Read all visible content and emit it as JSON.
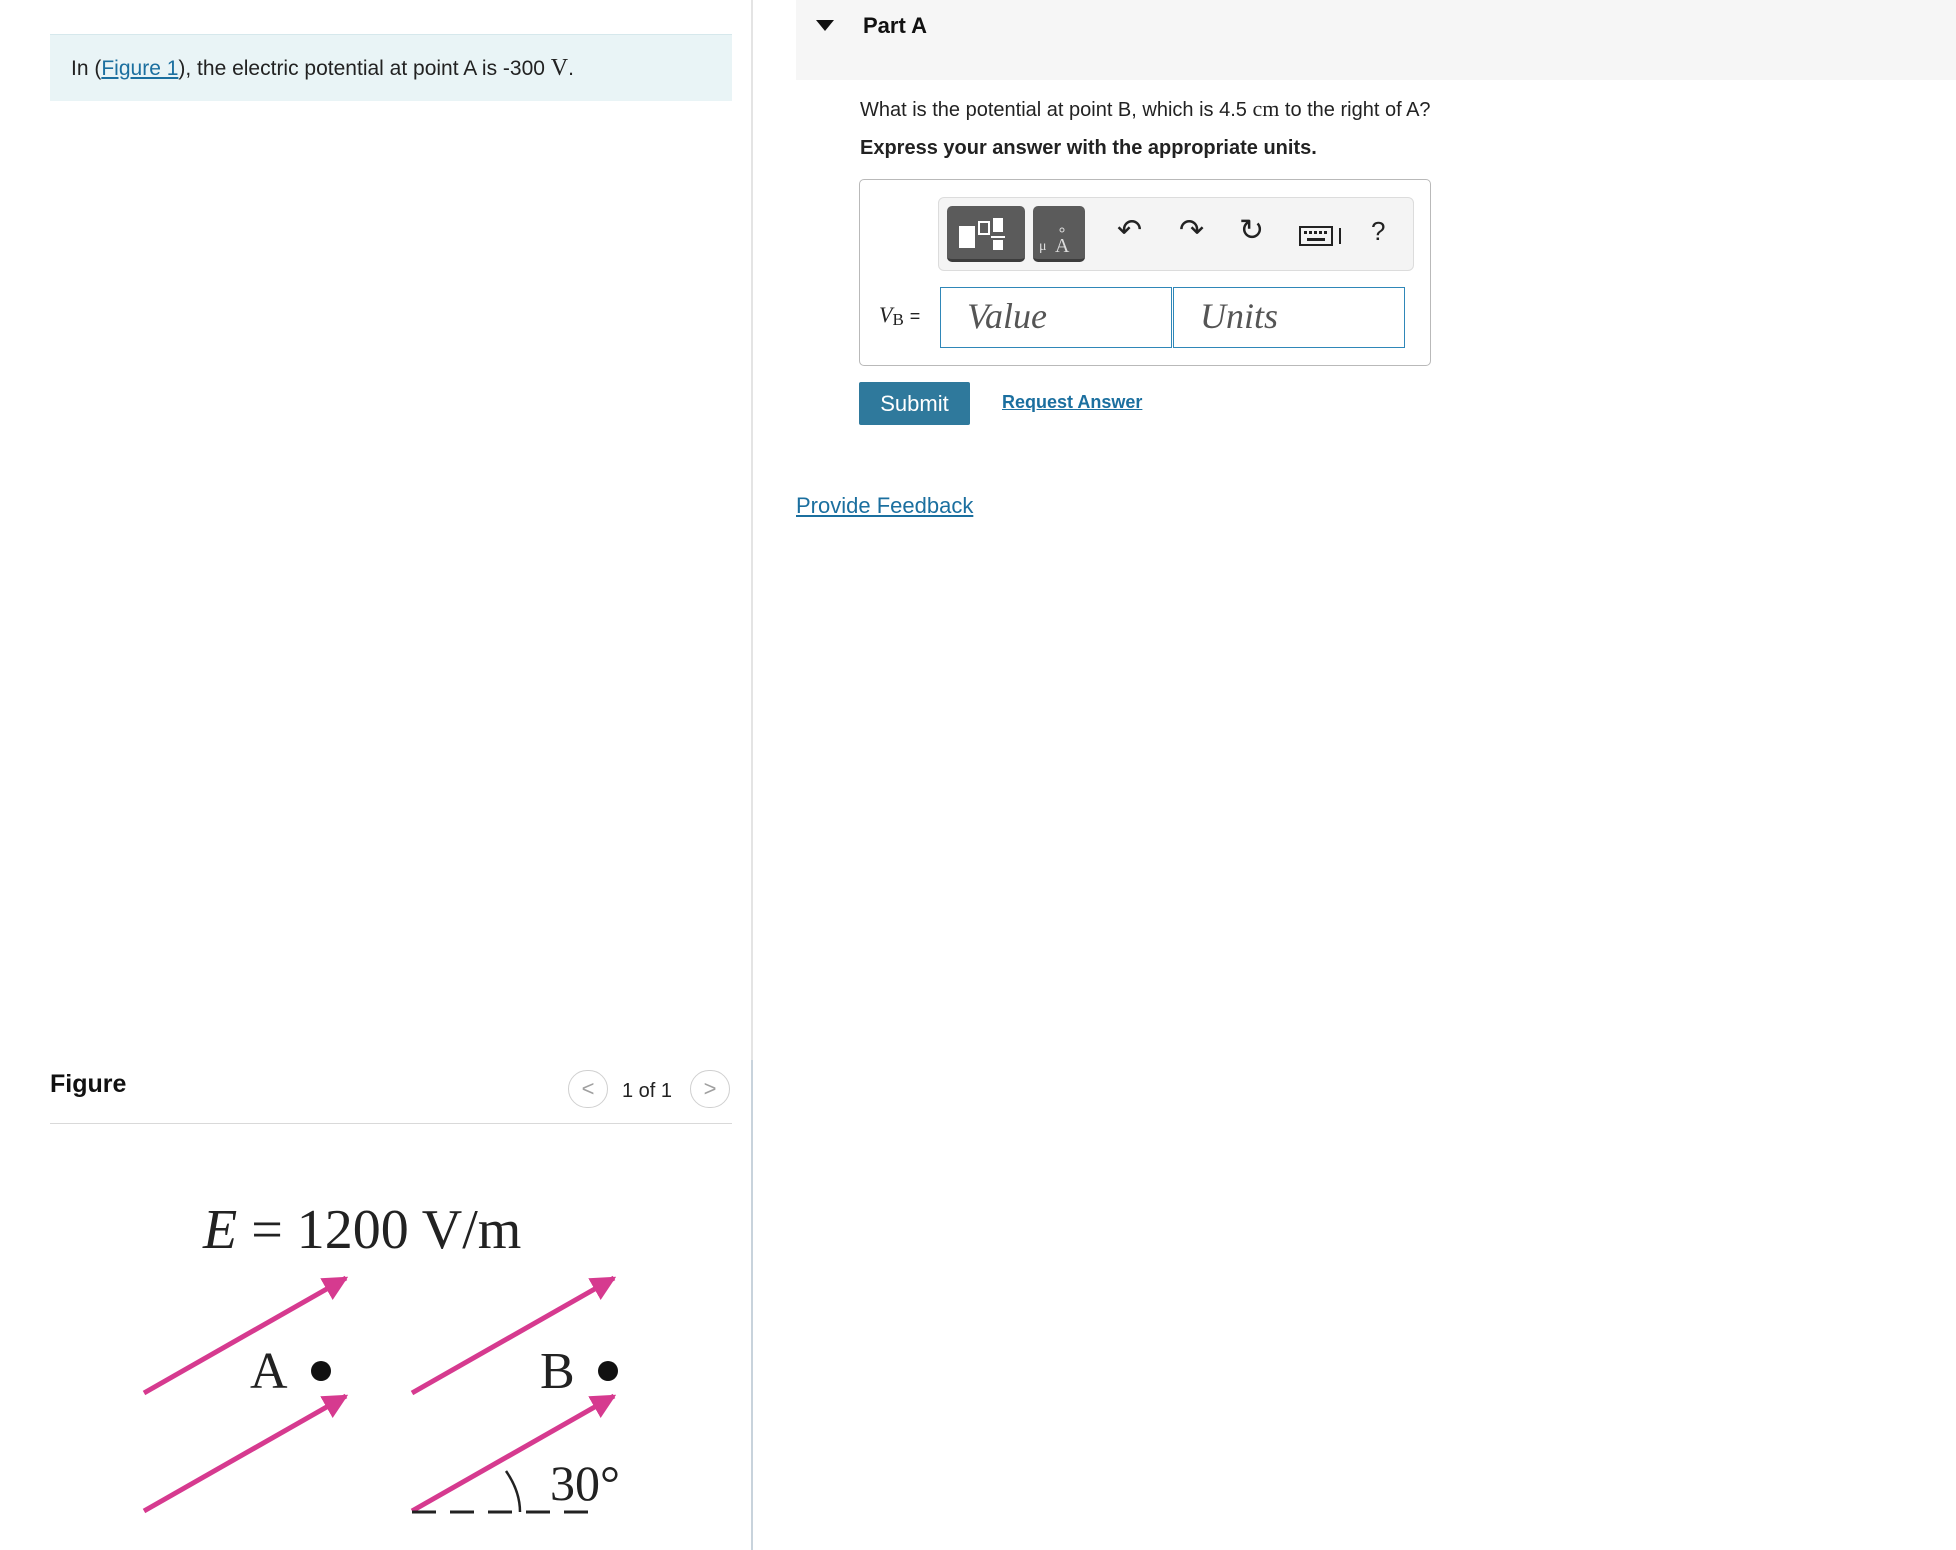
{
  "problem": {
    "prefix": "In (",
    "figure_link": "Figure 1",
    "suffix": "), the electric potential at point A is -300 ",
    "unit": "V",
    "end": "."
  },
  "figure_panel": {
    "title": "Figure",
    "page_indicator": "1 of 1",
    "prev_glyph": "<",
    "next_glyph": ">",
    "field_label_E": "E",
    "field_label_rest": "= 1200 V/m",
    "point_a": "A",
    "point_b": "B",
    "angle_label": "30°",
    "arrow_color": "#d63a8f"
  },
  "part": {
    "title": "Part A",
    "question_prefix": "What is the potential at point B, which is 4.5 ",
    "question_unit": "cm",
    "question_suffix": " to the right of A?",
    "instruction": "Express your answer with the appropriate units.",
    "answer_label_var": "V",
    "answer_label_sub": "B",
    "answer_label_eq": "=",
    "value_placeholder": "Value",
    "units_placeholder": "Units",
    "toolbar_icons": [
      "templates-icon",
      "units-icon",
      "undo-icon",
      "redo-icon",
      "reset-icon",
      "keyboard-icon",
      "help-icon"
    ],
    "help_glyph": "?",
    "submit_label": "Submit",
    "request_label": "Request Answer"
  },
  "feedback_label": "Provide Feedback",
  "colors": {
    "accent_blue": "#2f799c",
    "link_blue": "#1b6f9f",
    "problem_bg": "#e9f4f6"
  }
}
